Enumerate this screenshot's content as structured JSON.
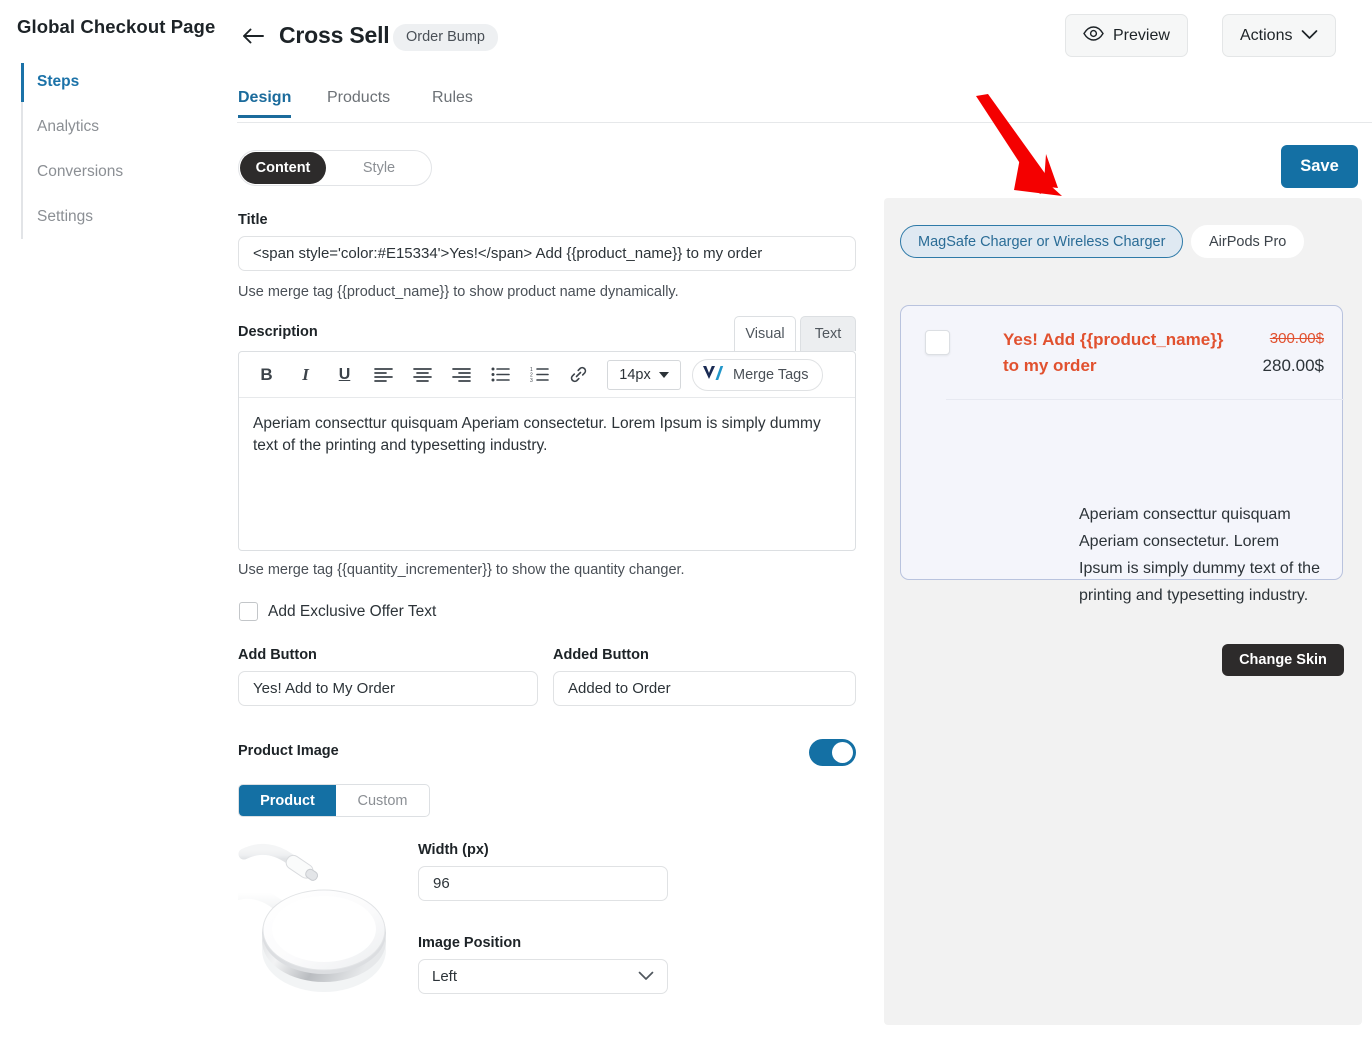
{
  "sidebar": {
    "title": "Global Checkout Page",
    "items": [
      {
        "label": "Steps",
        "name": "steps",
        "active": true
      },
      {
        "label": "Analytics",
        "name": "analytics",
        "active": false
      },
      {
        "label": "Conversions",
        "name": "conversions",
        "active": false
      },
      {
        "label": "Settings",
        "name": "settings",
        "active": false
      }
    ]
  },
  "header": {
    "back_icon": "arrow-left-icon",
    "title": "Cross Sell",
    "badge": "Order Bump",
    "preview_label": "Preview",
    "preview_icon": "eye-icon",
    "actions_label": "Actions",
    "actions_icon": "chevron-down-icon",
    "save_label": "Save"
  },
  "tabs": [
    {
      "label": "Design",
      "active": true
    },
    {
      "label": "Products",
      "active": false
    },
    {
      "label": "Rules",
      "active": false
    }
  ],
  "segment": {
    "content_label": "Content",
    "style_label": "Style"
  },
  "form": {
    "title_label": "Title",
    "title_value": "<span style='color:#E15334'>Yes!</span> Add {{product_name}} to my order",
    "title_placeholder": "Enter title",
    "title_help": "Use merge tag {{product_name}} to show product name dynamically.",
    "description_label": "Description",
    "editor_tabs": {
      "visual": "Visual",
      "text": "Text"
    },
    "toolbar": {
      "bold": "B",
      "italic": "I",
      "underline": "U",
      "align_left_icon": "align-left-icon",
      "align_center_icon": "align-center-icon",
      "align_right_icon": "align-right-icon",
      "bullet_list_icon": "bullet-list-icon",
      "numbered_list_icon": "numbered-list-icon",
      "link_icon": "link-icon",
      "font_size": "14px",
      "merge_tags_label": "Merge Tags",
      "merge_tags_icon": "v-slash-logo-icon"
    },
    "description_value": "Aperiam consecttur quisquam Aperiam consectetur. Lorem Ipsum is simply dummy text of the printing and typesetting industry.",
    "description_help": "Use merge tag {{quantity_incrementer}} to show the quantity changer.",
    "exclusive_offer_label": "Add Exclusive Offer Text",
    "exclusive_offer_checked": false,
    "add_button_label": "Add Button",
    "add_button_value": "Yes! Add to My Order",
    "added_button_label": "Added Button",
    "added_button_value": "Added to Order",
    "product_image_label": "Product Image",
    "product_image_enabled": true,
    "product_image_source": {
      "product": "Product",
      "custom": "Custom",
      "selected": "Product"
    },
    "product_photo_alt": "magsafe-charger-photo",
    "width_label": "Width (px)",
    "width_value": "96",
    "image_position_label": "Image Position",
    "image_position_value": "Left"
  },
  "preview": {
    "product_tabs": [
      {
        "label": "MagSafe Charger or Wireless Charger",
        "active": true
      },
      {
        "label": "AirPods Pro",
        "active": false
      }
    ],
    "bump": {
      "checkbox_checked": false,
      "title": "Yes! Add {{product_name}} to my order",
      "price_original": "300.00$",
      "price_current": "280.00$",
      "description": "Aperiam consecttur quisquam Aperiam consectetur. Lorem Ipsum is simply dummy text of the printing and typesetting industry."
    },
    "change_skin_label": "Change Skin"
  },
  "annotation": {
    "arrow": "red-arrow-pointing-down-right"
  },
  "colors": {
    "accent_blue": "#1470a4",
    "dark_pill": "#2d2b2b",
    "bump_orange": "#e1512f",
    "arrow_red": "#f40000",
    "panel_bg": "#f2f2f2",
    "card_bg": "#f4f5fb",
    "card_border": "#b9c3de"
  }
}
